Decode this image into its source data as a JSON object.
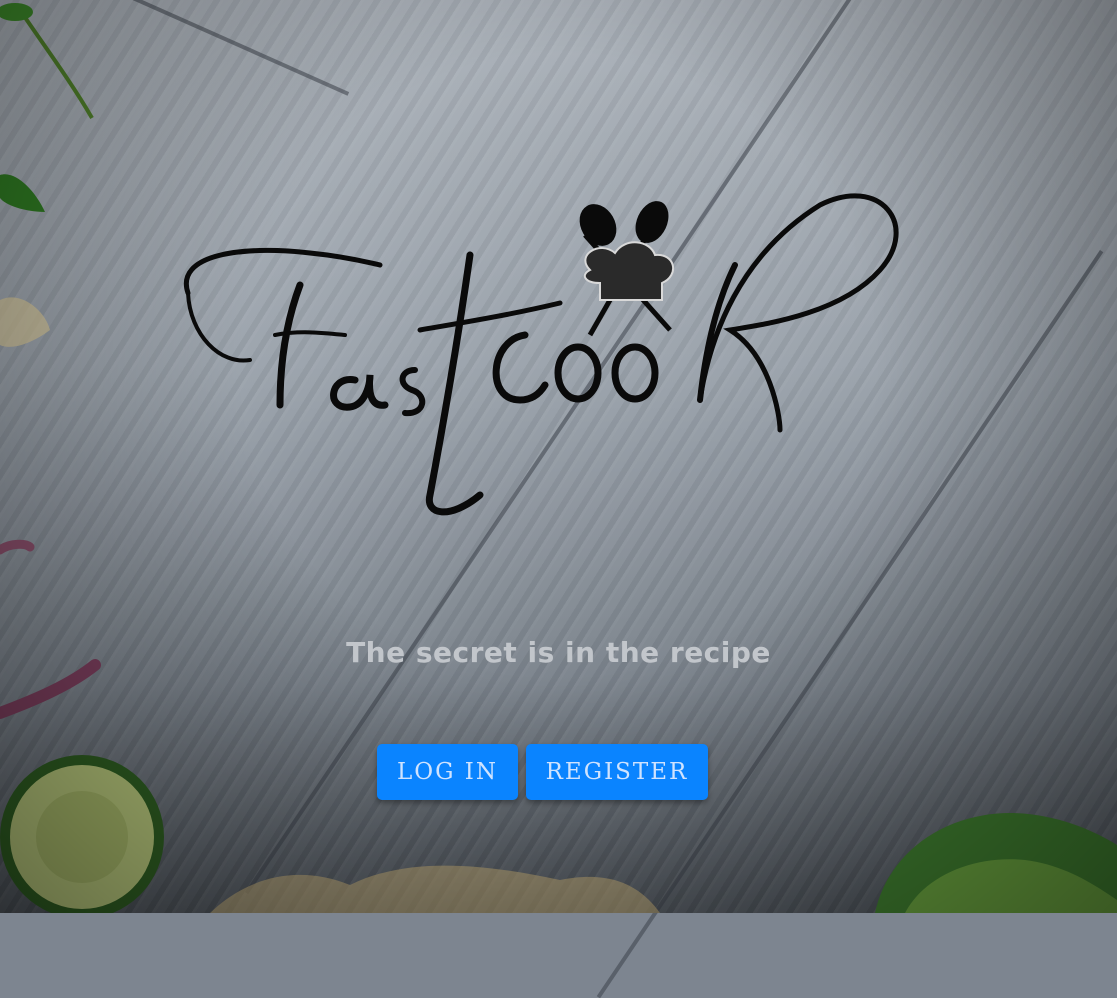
{
  "brand": {
    "name": "Fastcook",
    "logo_icon": "crossed-spoons-chef-hat-icon"
  },
  "tagline": "The secret is in the recipe",
  "actions": {
    "login_label": "LOG IN",
    "register_label": "REGISTER"
  },
  "colors": {
    "button": "#0a84ff",
    "button_text": "#cfe3ff",
    "tagline": "#c2c6cb",
    "logo": "#0a0a0a"
  }
}
